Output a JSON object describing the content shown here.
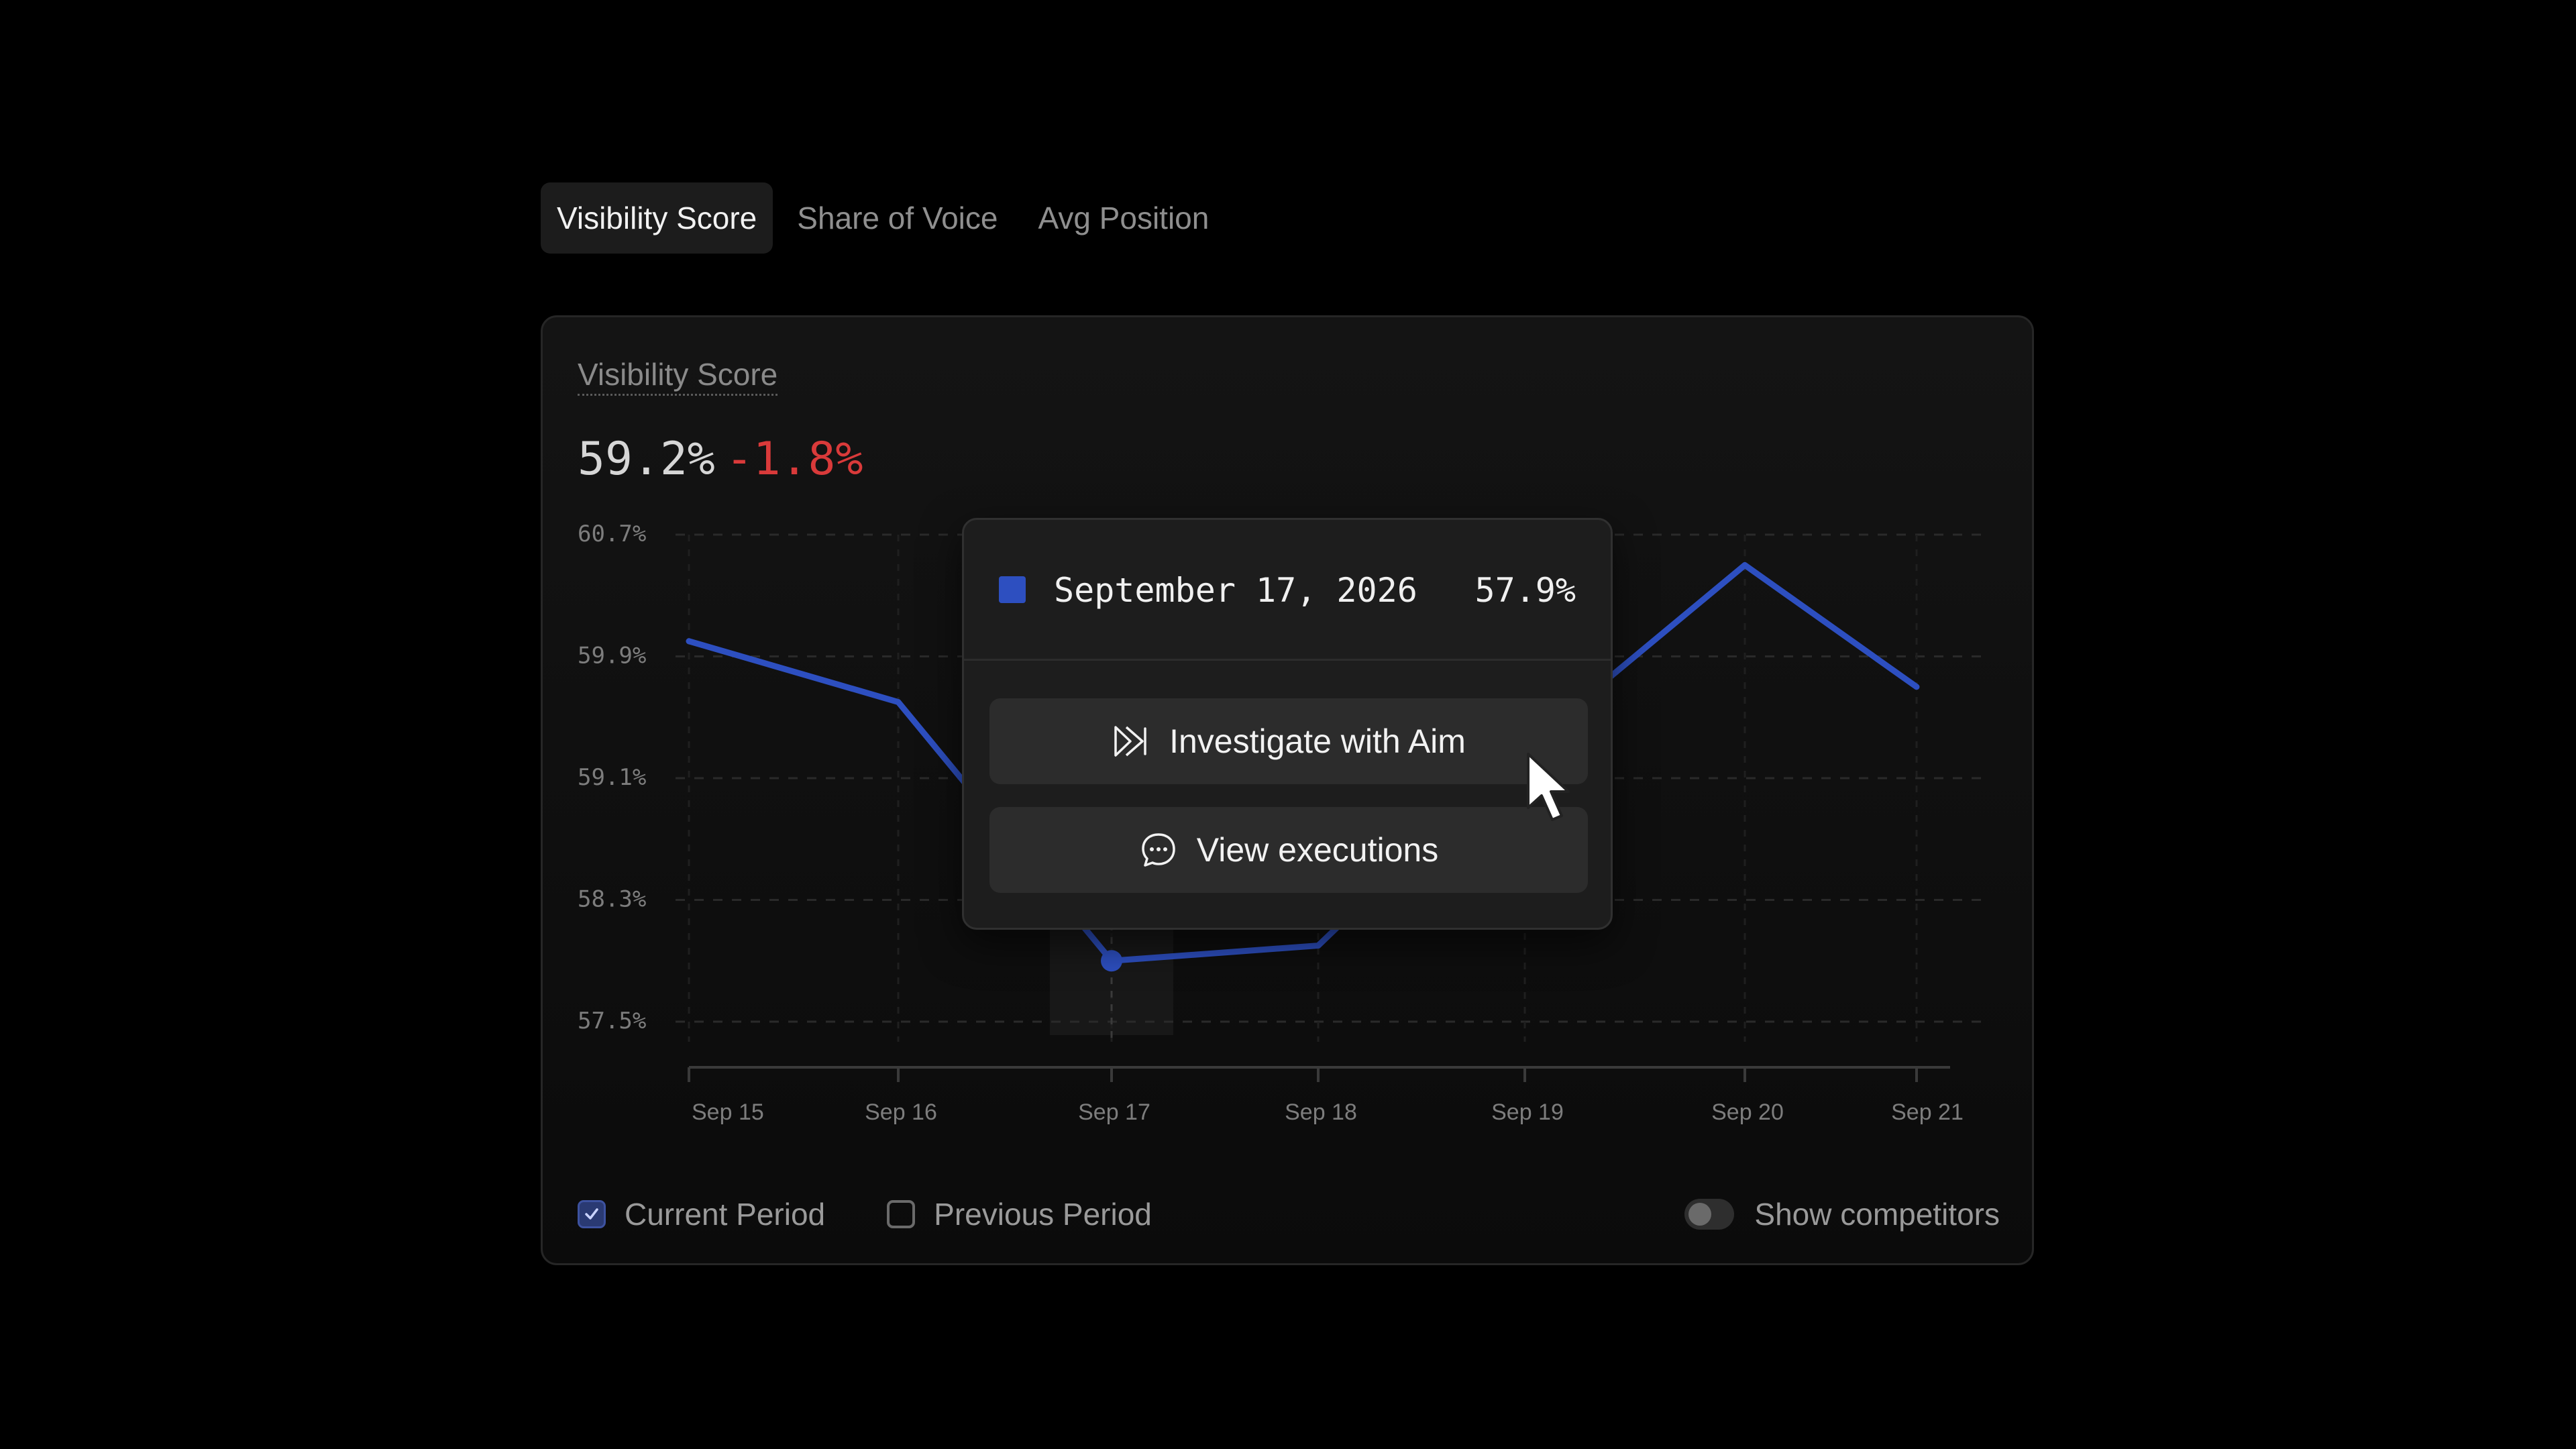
{
  "tabs": [
    {
      "label": "Visibility Score",
      "active": true
    },
    {
      "label": "Share of Voice",
      "active": false
    },
    {
      "label": "Avg Position",
      "active": false
    }
  ],
  "card": {
    "title": "Visibility Score",
    "value": "59.2%",
    "delta": "-1.8%"
  },
  "chart_data": {
    "type": "line",
    "categories": [
      "Sep 15",
      "Sep 16",
      "Sep 17",
      "Sep 18",
      "Sep 19",
      "Sep 20",
      "Sep 21"
    ],
    "series": [
      {
        "values": [
          60.0,
          59.6,
          57.9,
          58.0,
          59.3,
          60.5,
          59.7
        ],
        "color": "#2d4fc0"
      }
    ],
    "yticks": [
      "60.7%",
      "59.9%",
      "59.1%",
      "58.3%",
      "57.5%"
    ],
    "ylim": [
      57.5,
      60.7
    ],
    "grid": true,
    "highlight_category": "Sep 17"
  },
  "tooltip": {
    "date": "September 17, 2026",
    "value": "57.9%",
    "swatch_color": "#2d4fc0",
    "investigate_label": "Investigate with Aim",
    "investigate_icon": "fast-forward-icon",
    "executions_label": "View executions",
    "executions_icon": "chat-bubble-icon"
  },
  "legend": {
    "current_label": "Current Period",
    "current_checked": true,
    "previous_label": "Previous Period",
    "previous_checked": false,
    "competitors_label": "Show competitors",
    "competitors_on": false
  },
  "colors": {
    "accent": "#2d4fc0",
    "negative": "#d93a3a"
  }
}
